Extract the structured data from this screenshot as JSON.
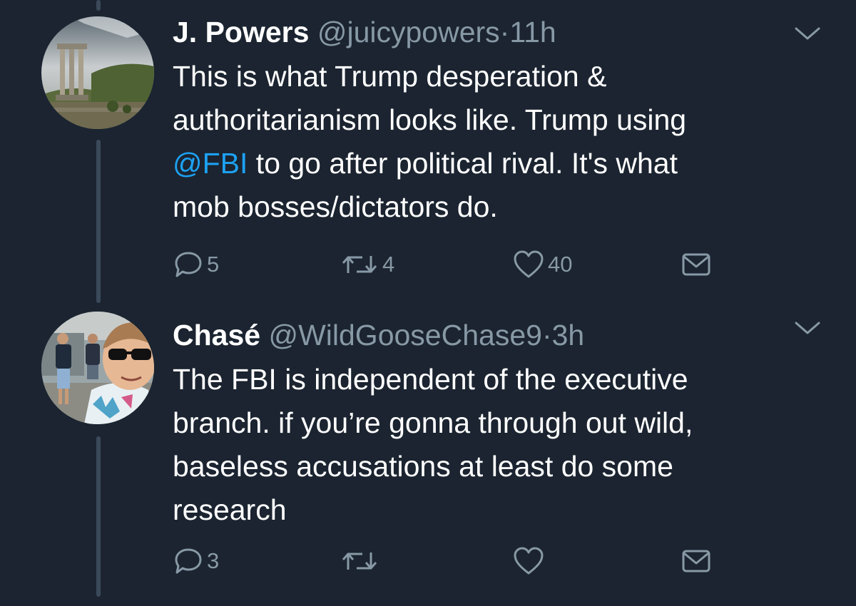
{
  "tweets": [
    {
      "display_name": "J. Powers",
      "handle": "@juicypowers",
      "separator": "·",
      "time": "11h",
      "text_line_1": "This is what Trump desperation &",
      "text_line_2": "authoritarianism looks like.  Trump using",
      "text_line_3_mention": "@FBI",
      "text_line_3_rest": " to go after political rival. It's what",
      "text_line_4": "mob bosses/dictators do.",
      "reply_count": "5",
      "retweet_count": "4",
      "like_count": "40",
      "avatar_icon": "greek-temple-ruins-photo"
    },
    {
      "display_name": "Chasé",
      "handle": "@WildGooseChase9",
      "separator": "·",
      "time": "3h",
      "text_line_1": "The FBI is independent of the executive",
      "text_line_2": "branch. if you’re gonna through out wild,",
      "text_line_3": "baseless accusations at least do some",
      "text_line_4": "research",
      "reply_count": "3",
      "retweet_count": "",
      "like_count": "",
      "avatar_icon": "selfie-with-sunglasses-photo"
    }
  ],
  "colors": {
    "background": "#1b2430",
    "text": "#ffffff",
    "muted": "#8899a6",
    "link": "#1da1f2",
    "thread_line": "#3b4a5a"
  },
  "icons": {
    "reply": "reply-bubble-icon",
    "retweet": "retweet-icon",
    "like": "heart-icon",
    "dm": "envelope-icon",
    "menu": "chevron-down-icon"
  }
}
